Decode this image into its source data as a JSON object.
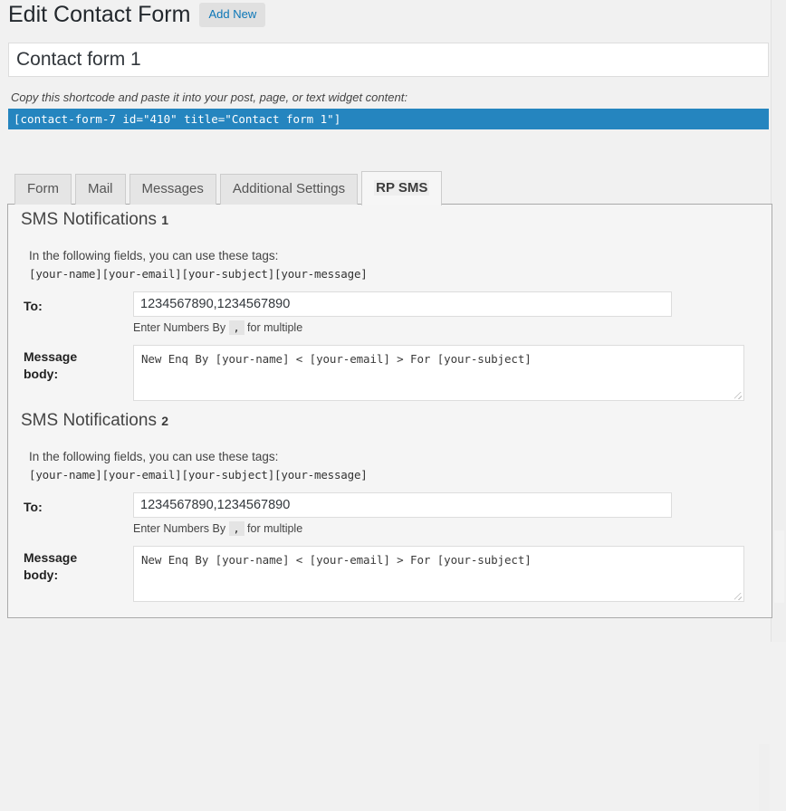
{
  "header": {
    "title": "Edit Contact Form",
    "add_new_label": "Add New"
  },
  "title_field": {
    "value": "Contact form 1"
  },
  "shortcode": {
    "label": "Copy this shortcode and paste it into your post, page, or text widget content:",
    "value": "[contact-form-7 id=\"410\" title=\"Contact form 1\"]",
    "background_color": "#2585bf"
  },
  "tabs": [
    {
      "label": "Form",
      "active": false
    },
    {
      "label": "Mail",
      "active": false
    },
    {
      "label": "Messages",
      "active": false
    },
    {
      "label": "Additional Settings",
      "active": false
    },
    {
      "label": "RP SMS",
      "active": true
    }
  ],
  "sections": [
    {
      "heading": "SMS Notifications",
      "index": "1",
      "hint": "In the following fields, you can use these tags:",
      "tags": "[your-name][your-email][your-subject][your-message]",
      "to_label": "To:",
      "to_value": "1234567890,1234567890",
      "note_before": "Enter Numbers By",
      "note_code": ",",
      "note_after": "for multiple",
      "body_label_line1": "Message",
      "body_label_line2": "body:",
      "body_value": "New Enq By [your-name] < [your-email] > For [your-subject]"
    },
    {
      "heading": "SMS Notifications",
      "index": "2",
      "hint": "In the following fields, you can use these tags:",
      "tags": "[your-name][your-email][your-subject][your-message]",
      "to_label": "To:",
      "to_value": "1234567890,1234567890",
      "note_before": "Enter Numbers By",
      "note_code": ",",
      "note_after": "for multiple",
      "body_label_line1": "Message",
      "body_label_line2": "body:",
      "body_value": "New Enq By [your-name] < [your-email] > For [your-subject]"
    }
  ]
}
